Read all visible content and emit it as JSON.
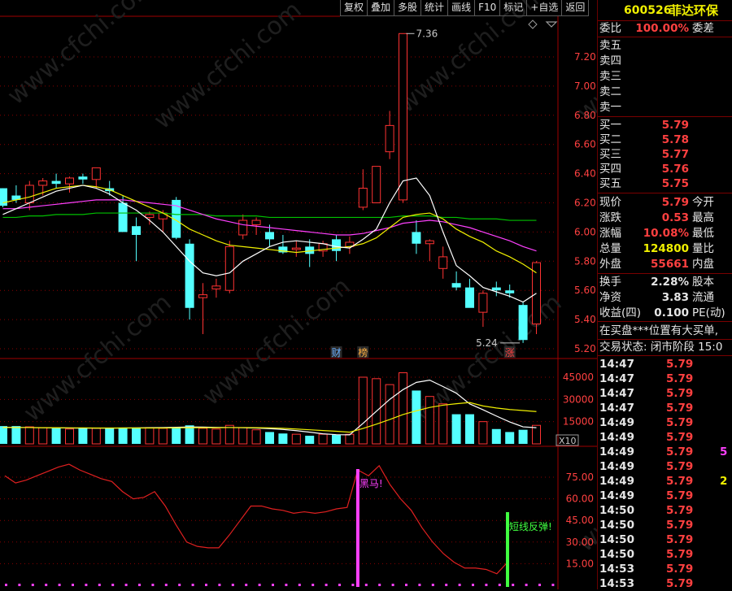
{
  "toolbar": [
    "复权",
    "叠加",
    "多股",
    "统计",
    "画线",
    "F10",
    "标记",
    "+自选",
    "返回"
  ],
  "stock": {
    "code": "600526",
    "name": "菲达环保"
  },
  "quote": {
    "weibi_label": "委比",
    "weibi_value": "100.00%",
    "weicha_label": "委差",
    "sell_labels": [
      "卖五",
      "卖四",
      "卖三",
      "卖二",
      "卖一"
    ],
    "buy": [
      {
        "label": "买一",
        "price": "5.79"
      },
      {
        "label": "买二",
        "price": "5.78"
      },
      {
        "label": "买三",
        "price": "5.77"
      },
      {
        "label": "买四",
        "price": "5.76"
      },
      {
        "label": "买五",
        "price": "5.75"
      }
    ],
    "stats1": [
      {
        "label": "现价",
        "value": "5.79",
        "color": "#ff4040",
        "label2": "今开"
      },
      {
        "label": "涨跌",
        "value": "0.53",
        "color": "#ff4040",
        "label2": "最高"
      },
      {
        "label": "涨幅",
        "value": "10.08%",
        "color": "#ff4040",
        "label2": "最低"
      },
      {
        "label": "总量",
        "value": "124800",
        "color": "#f0f000",
        "label2": "量比"
      },
      {
        "label": "外盘",
        "value": "55661",
        "color": "#ff4040",
        "label2": "内盘"
      }
    ],
    "stats2": [
      {
        "label": "换手",
        "value": "2.28%",
        "color": "#e6e6e6",
        "label2": "股本"
      },
      {
        "label": "净资",
        "value": "3.83",
        "color": "#e6e6e6",
        "label2": "流通"
      },
      {
        "label": "收益(四)",
        "value": "0.100",
        "color": "#e6e6e6",
        "label2": "PE(动)"
      }
    ],
    "notice": "在买盘***位置有大买单,",
    "trade_status": "交易状态: 闭市阶段 15:0",
    "ticks": [
      {
        "time": "14:47",
        "price": "5.79",
        "vol": ""
      },
      {
        "time": "14:47",
        "price": "5.79",
        "vol": ""
      },
      {
        "time": "14:47",
        "price": "5.79",
        "vol": ""
      },
      {
        "time": "14:47",
        "price": "5.79",
        "vol": ""
      },
      {
        "time": "14:49",
        "price": "5.79",
        "vol": ""
      },
      {
        "time": "14:49",
        "price": "5.79",
        "vol": ""
      },
      {
        "time": "14:49",
        "price": "5.79",
        "vol": "5"
      },
      {
        "time": "14:49",
        "price": "5.79",
        "vol": ""
      },
      {
        "time": "14:49",
        "price": "5.79",
        "vol": "2"
      },
      {
        "time": "14:49",
        "price": "5.79",
        "vol": ""
      },
      {
        "time": "14:50",
        "price": "5.79",
        "vol": ""
      },
      {
        "time": "14:50",
        "price": "5.79",
        "vol": ""
      },
      {
        "time": "14:50",
        "price": "5.79",
        "vol": ""
      },
      {
        "time": "14:50",
        "price": "5.79",
        "vol": ""
      },
      {
        "time": "14:53",
        "price": "5.79",
        "vol": ""
      },
      {
        "time": "14:53",
        "price": "5.79",
        "vol": ""
      }
    ]
  },
  "colors": {
    "up": "#ff3232",
    "down": "#54ffff",
    "ma5": "#ffffff",
    "ma10": "#f0f000",
    "ma20": "#ff40ff",
    "ma60": "#00c000"
  },
  "chart_data": [
    {
      "type": "candlestick",
      "ylim": [
        5.15,
        7.48
      ],
      "y_ticks": [
        "7.20",
        "7.00",
        "6.80",
        "6.60",
        "6.40",
        "6.20",
        "6.00",
        "5.80",
        "5.60",
        "5.40",
        "5.20"
      ],
      "candles": [
        [
          6.3,
          6.3,
          6.17,
          6.18
        ],
        [
          6.25,
          6.32,
          6.2,
          6.22
        ],
        [
          6.2,
          6.35,
          6.15,
          6.32
        ],
        [
          6.32,
          6.37,
          6.25,
          6.35
        ],
        [
          6.35,
          6.4,
          6.3,
          6.33
        ],
        [
          6.33,
          6.38,
          6.27,
          6.37
        ],
        [
          6.38,
          6.4,
          6.33,
          6.36
        ],
        [
          6.36,
          6.44,
          6.3,
          6.44
        ],
        [
          6.3,
          6.35,
          6.25,
          6.28
        ],
        [
          6.2,
          6.25,
          6.08,
          6.0
        ],
        [
          6.04,
          6.1,
          5.8,
          5.98
        ],
        [
          6.1,
          6.14,
          6.05,
          6.12
        ],
        [
          6.09,
          6.15,
          6.0,
          6.13
        ],
        [
          6.22,
          6.24,
          5.95,
          5.96
        ],
        [
          5.92,
          5.95,
          5.4,
          5.48
        ],
        [
          5.55,
          5.65,
          5.3,
          5.57
        ],
        [
          5.61,
          5.68,
          5.55,
          5.63
        ],
        [
          5.6,
          5.94,
          5.58,
          5.9
        ],
        [
          5.98,
          6.12,
          5.95,
          6.08
        ],
        [
          6.05,
          6.1,
          5.98,
          6.08
        ],
        [
          6.0,
          6.05,
          5.9,
          5.95
        ],
        [
          5.9,
          5.98,
          5.85,
          5.86
        ],
        [
          5.88,
          5.94,
          5.83,
          5.89
        ],
        [
          5.9,
          5.95,
          5.76,
          5.85
        ],
        [
          5.87,
          5.94,
          5.83,
          5.92
        ],
        [
          5.95,
          5.98,
          5.8,
          5.87
        ],
        [
          5.9,
          5.97,
          5.85,
          5.93
        ],
        [
          6.17,
          6.43,
          6.15,
          6.3
        ],
        [
          6.2,
          6.45,
          6.2,
          6.45
        ],
        [
          6.55,
          6.83,
          6.5,
          6.73
        ],
        [
          6.22,
          7.36,
          6.2,
          7.36
        ],
        [
          6.0,
          6.08,
          5.85,
          5.92
        ],
        [
          5.92,
          5.95,
          5.8,
          5.94
        ],
        [
          5.75,
          5.9,
          5.68,
          5.83
        ],
        [
          5.65,
          5.73,
          5.6,
          5.62
        ],
        [
          5.62,
          5.68,
          5.5,
          5.48
        ],
        [
          5.45,
          5.6,
          5.35,
          5.58
        ],
        [
          5.62,
          5.66,
          5.56,
          5.6
        ],
        [
          5.6,
          5.64,
          5.55,
          5.58
        ],
        [
          5.5,
          5.52,
          5.24,
          5.26
        ],
        [
          5.37,
          5.8,
          5.3,
          5.79
        ]
      ],
      "ma5": [
        6.12,
        6.16,
        6.2,
        6.24,
        6.28,
        6.3,
        6.32,
        6.3,
        6.26,
        6.2,
        6.15,
        6.08,
        6.0,
        5.9,
        5.8,
        5.72,
        5.7,
        5.72,
        5.8,
        5.85,
        5.9,
        5.93,
        5.94,
        5.93,
        5.92,
        5.9,
        5.89,
        5.95,
        6.02,
        6.2,
        6.35,
        6.37,
        6.25,
        6.0,
        5.77,
        5.7,
        5.62,
        5.59,
        5.56,
        5.52,
        5.58
      ],
      "ma10": [
        6.2,
        6.22,
        6.24,
        6.27,
        6.3,
        6.31,
        6.32,
        6.31,
        6.29,
        6.25,
        6.21,
        6.17,
        6.13,
        6.08,
        6.02,
        5.98,
        5.94,
        5.91,
        5.9,
        5.89,
        5.88,
        5.87,
        5.86,
        5.87,
        5.88,
        5.89,
        5.9,
        5.92,
        5.96,
        6.03,
        6.1,
        6.12,
        6.13,
        6.09,
        6.02,
        5.97,
        5.93,
        5.87,
        5.83,
        5.78,
        5.72
      ],
      "ma20": [
        6.16,
        6.16,
        6.17,
        6.18,
        6.19,
        6.2,
        6.21,
        6.22,
        6.22,
        6.22,
        6.21,
        6.2,
        6.19,
        6.18,
        6.15,
        6.12,
        6.09,
        6.07,
        6.05,
        6.04,
        6.03,
        6.02,
        6.01,
        6.0,
        5.99,
        5.98,
        5.98,
        5.99,
        6.01,
        6.03,
        6.06,
        6.07,
        6.08,
        6.07,
        6.05,
        6.03,
        6.0,
        5.97,
        5.94,
        5.9,
        5.87
      ],
      "ma60": [
        6.1,
        6.1,
        6.11,
        6.11,
        6.12,
        6.12,
        6.12,
        6.13,
        6.13,
        6.13,
        6.13,
        6.13,
        6.13,
        6.12,
        6.12,
        6.12,
        6.11,
        6.11,
        6.11,
        6.11,
        6.1,
        6.1,
        6.1,
        6.1,
        6.1,
        6.1,
        6.1,
        6.1,
        6.1,
        6.1,
        6.11,
        6.11,
        6.11,
        6.1,
        6.1,
        6.09,
        6.09,
        6.09,
        6.08,
        6.08,
        6.08
      ],
      "high_label": "7.36",
      "low_label": "5.24",
      "markers": [
        {
          "index": 25,
          "text": "财",
          "color": "#6ab0ff"
        },
        {
          "index": 27,
          "text": "榜",
          "color": "#ffb040"
        },
        {
          "index": 38,
          "text": "涨",
          "color": "#ff4040"
        }
      ]
    },
    {
      "type": "bar",
      "name": "volume",
      "ylim": [
        0,
        50000
      ],
      "y_ticks": [
        "45000",
        "30000",
        "15000"
      ],
      "unit_label": "X10",
      "values": [
        12000,
        12000,
        11500,
        11000,
        10500,
        10000,
        11000,
        10500,
        10500,
        11000,
        11000,
        11000,
        10500,
        11000,
        12500,
        10500,
        10000,
        12500,
        11000,
        9500,
        8000,
        7000,
        6500,
        5500,
        6500,
        6000,
        6500,
        45000,
        44000,
        40000,
        48000,
        36000,
        32000,
        27000,
        20000,
        20000,
        15000,
        10000,
        8000,
        9500,
        12500
      ],
      "ma5": [
        11200,
        11100,
        11000,
        10900,
        10800,
        10700,
        10600,
        10600,
        10600,
        10700,
        10800,
        10900,
        11000,
        11200,
        11400,
        11300,
        11100,
        11000,
        10900,
        10700,
        10300,
        9700,
        8900,
        7900,
        6800,
        6200,
        6100,
        13800,
        22000,
        30000,
        36600,
        41500,
        43000,
        38700,
        34200,
        27000,
        23000,
        18800,
        14800,
        11500,
        10900
      ],
      "ma10": [
        11000,
        11000,
        11000,
        10900,
        10900,
        10800,
        10800,
        10700,
        10700,
        10700,
        10700,
        10700,
        10700,
        10800,
        10900,
        10900,
        10900,
        11000,
        11000,
        10900,
        10800,
        10500,
        10000,
        9500,
        9000,
        8500,
        7900,
        10400,
        13300,
        16400,
        19800,
        22300,
        24600,
        26100,
        27100,
        27900,
        25600,
        24200,
        23200,
        22500,
        21800
      ]
    },
    {
      "type": "line",
      "name": "indicator",
      "ylim": [
        0,
        90
      ],
      "y_ticks": [
        "75.00",
        "60.00",
        "45.00",
        "30.00",
        "15.00"
      ],
      "values": [
        76,
        71,
        73,
        76,
        79,
        82,
        84,
        80,
        77,
        74,
        72,
        65,
        60,
        61,
        65,
        55,
        42,
        30,
        27,
        26,
        26,
        35,
        45,
        55,
        55,
        53,
        52,
        50,
        51,
        50,
        51,
        53,
        54,
        80,
        76,
        83,
        70,
        60,
        52,
        40,
        30,
        22,
        16,
        12,
        12,
        11,
        8,
        16
      ],
      "signals": [
        {
          "index": 33,
          "text": "黑马!",
          "color": "#ff40ff"
        },
        {
          "index": 47,
          "text": "短线反弹!",
          "color": "#40ff40"
        }
      ]
    }
  ]
}
